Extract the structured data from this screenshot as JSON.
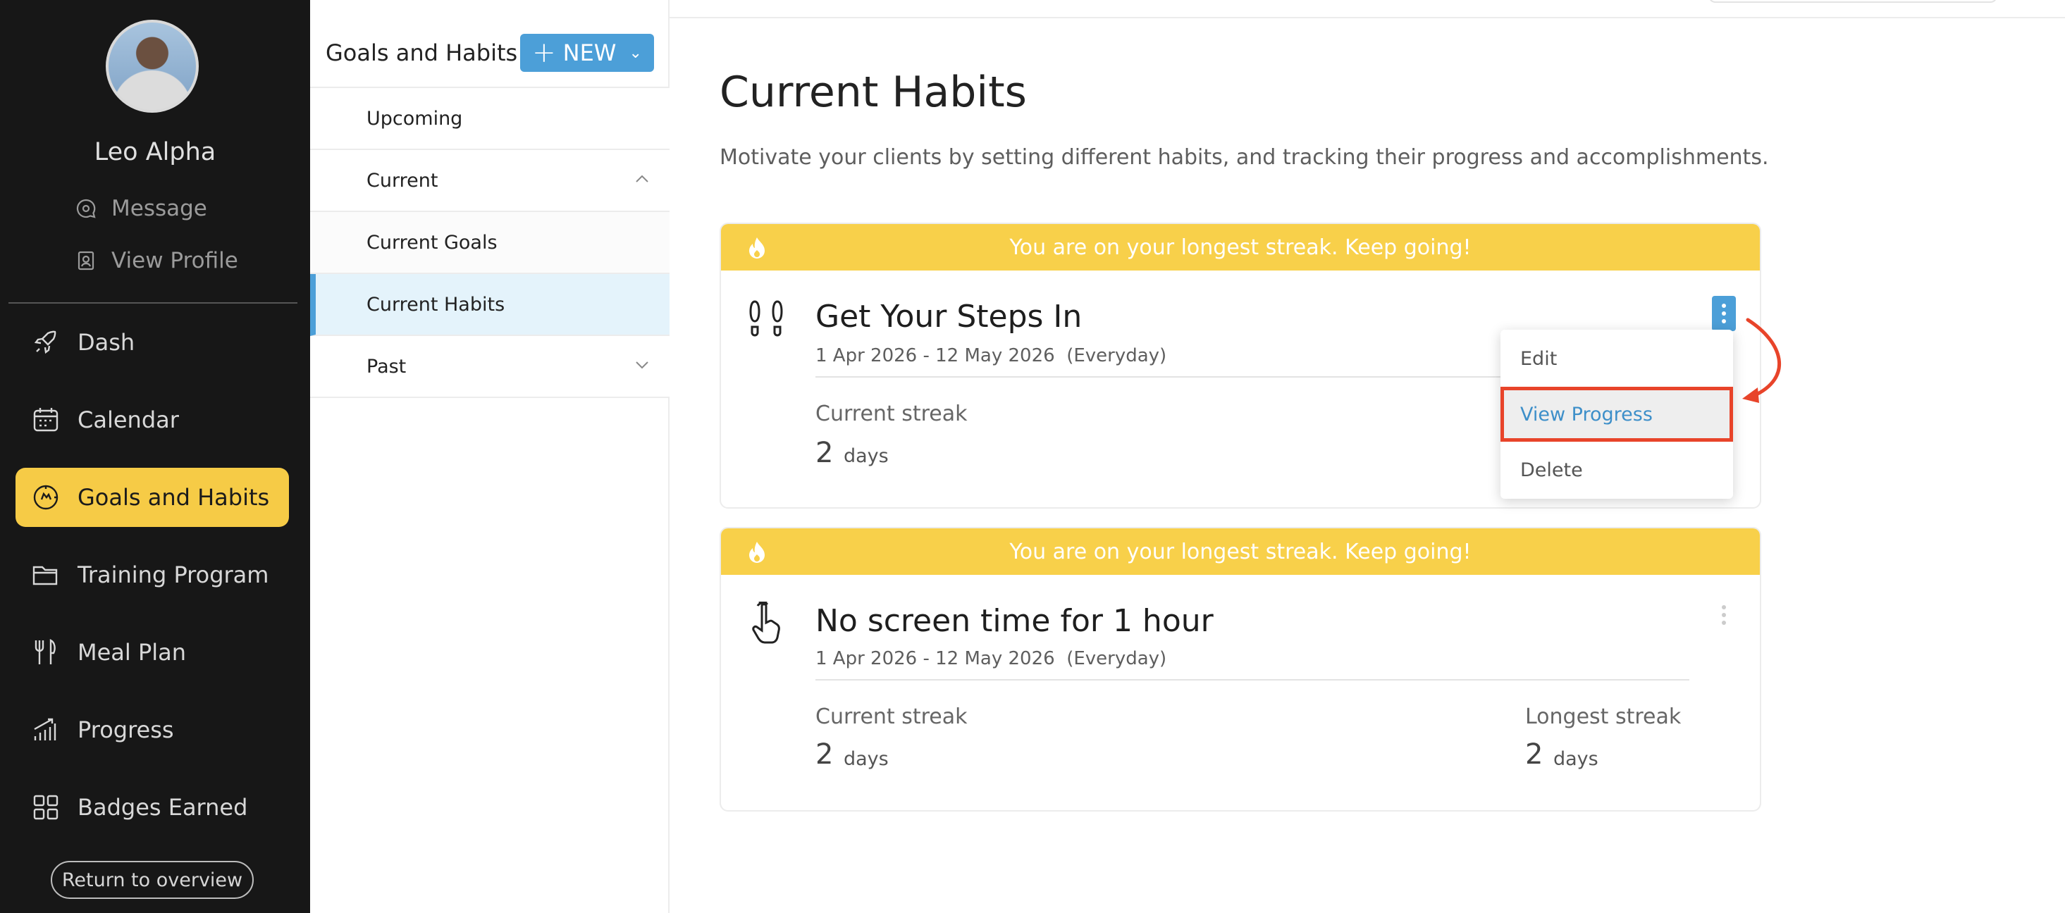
{
  "user": {
    "name": "Leo Alpha",
    "message_label": "Message",
    "view_profile_label": "View Profile"
  },
  "nav": {
    "items": [
      {
        "label": "Dash",
        "icon": "rocket-icon"
      },
      {
        "label": "Calendar",
        "icon": "calendar-icon"
      },
      {
        "label": "Goals and Habits",
        "icon": "target-icon",
        "active": true
      },
      {
        "label": "Training Program",
        "icon": "folder-icon"
      },
      {
        "label": "Meal Plan",
        "icon": "utensils-icon"
      },
      {
        "label": "Progress",
        "icon": "progress-chart-icon"
      },
      {
        "label": "Badges Earned",
        "icon": "grid-icon"
      }
    ],
    "return_label": "Return to overview"
  },
  "section": {
    "title": "Goals and Habits",
    "new_label": "NEW",
    "menu": [
      {
        "label": "Upcoming"
      },
      {
        "label": "Current"
      },
      {
        "label": "Current Goals"
      },
      {
        "label": "Current Habits",
        "selected": true
      },
      {
        "label": "Past"
      }
    ]
  },
  "main": {
    "title": "Current Habits",
    "description": "Motivate your clients by setting different habits, and tracking their progress and accomplishments."
  },
  "habits": [
    {
      "banner": "You are on your longest streak. Keep going!",
      "title": "Get Your Steps In",
      "dates": "1 Apr 2026 - 12 May 2026",
      "frequency": "(Everyday)",
      "current_label": "Current streak",
      "current_value": "2",
      "unit": "days",
      "icon": "footprints-icon"
    },
    {
      "banner": "You are on your longest streak. Keep going!",
      "title": "No screen time for 1 hour",
      "dates": "1 Apr 2026 - 12 May 2026",
      "frequency": "(Everyday)",
      "current_label": "Current streak",
      "current_value": "2",
      "longest_label": "Longest streak",
      "longest_value": "2",
      "unit": "days",
      "icon": "hand-tap-icon"
    }
  ],
  "dropdown": {
    "items": [
      "Edit",
      "View Progress",
      "Delete"
    ]
  },
  "colors": {
    "accent": "#4c9fd8",
    "banner": "#f8d04a",
    "active_nav": "#f6cb46",
    "annotation": "#e8442a"
  }
}
